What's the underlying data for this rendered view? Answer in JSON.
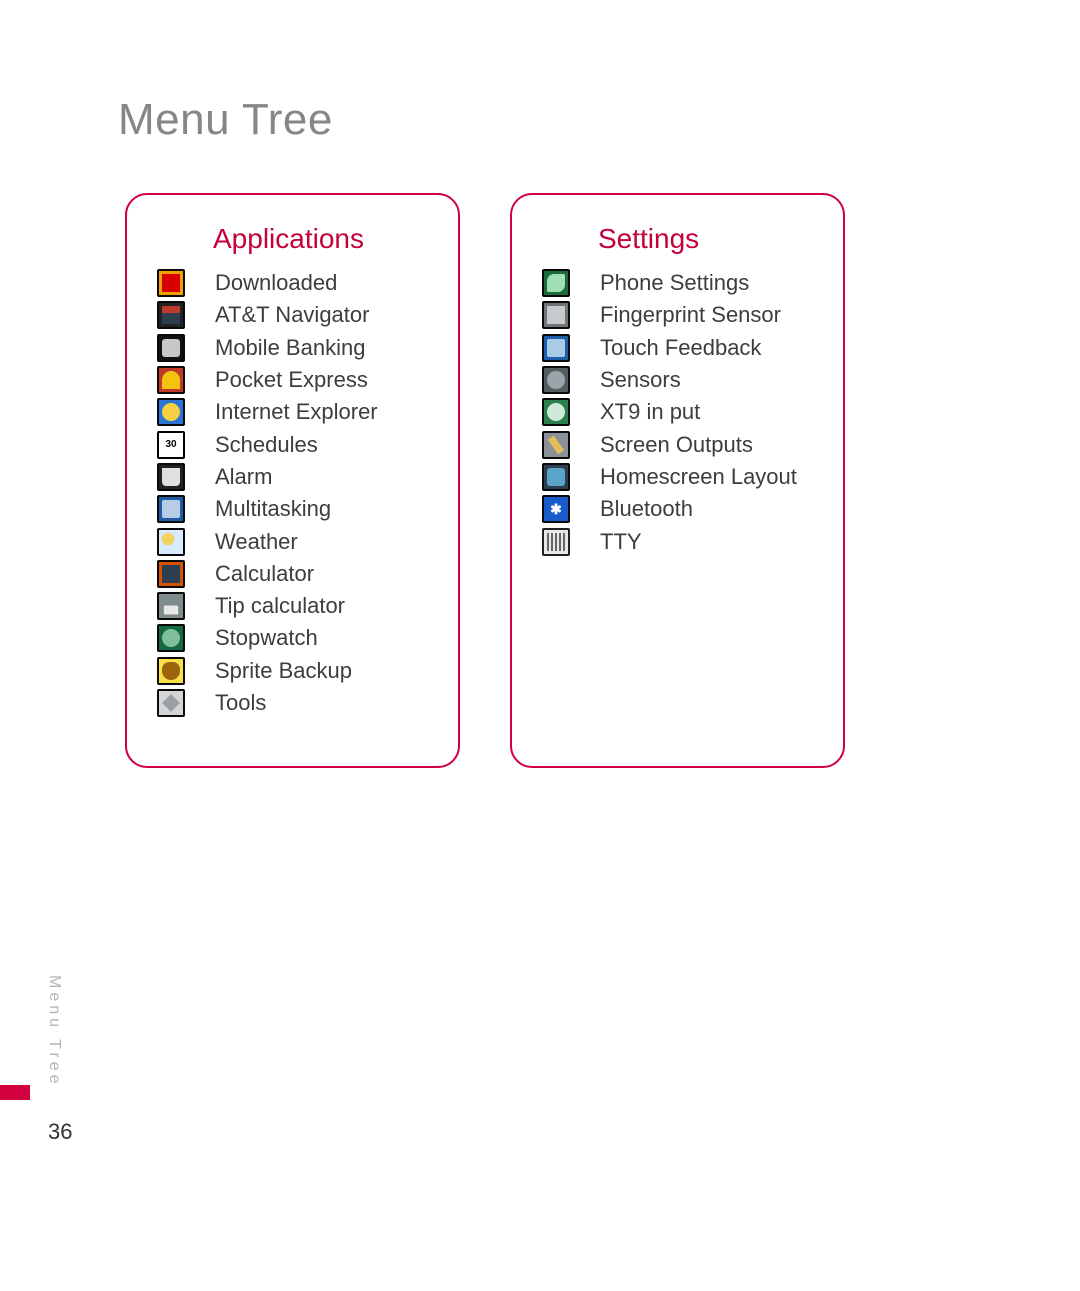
{
  "page": {
    "title": "Menu Tree",
    "section_label": "Menu Tree",
    "number": "36"
  },
  "accent_color": "#d1003f",
  "applications": {
    "heading": "Applications",
    "items": [
      {
        "label": "Downloaded",
        "icon": "download-icon"
      },
      {
        "label": "AT&T Navigator",
        "icon": "att-navigator-icon"
      },
      {
        "label": "Mobile Banking",
        "icon": "mobile-banking-icon"
      },
      {
        "label": "Pocket Express",
        "icon": "pocket-express-icon"
      },
      {
        "label": "Internet Explorer",
        "icon": "internet-explorer-icon"
      },
      {
        "label": "Schedules",
        "icon": "calendar-icon",
        "badge": "30"
      },
      {
        "label": "Alarm",
        "icon": "alarm-clock-icon"
      },
      {
        "label": "Multitasking",
        "icon": "multitasking-icon"
      },
      {
        "label": "Weather",
        "icon": "weather-icon"
      },
      {
        "label": "Calculator",
        "icon": "calculator-icon"
      },
      {
        "label": "Tip calculator",
        "icon": "tip-calculator-icon"
      },
      {
        "label": "Stopwatch",
        "icon": "stopwatch-icon"
      },
      {
        "label": "Sprite Backup",
        "icon": "sprite-backup-icon"
      },
      {
        "label": "Tools",
        "icon": "tools-icon"
      }
    ]
  },
  "settings": {
    "heading": "Settings",
    "items": [
      {
        "label": "Phone Settings",
        "icon": "phone-settings-icon"
      },
      {
        "label": "Fingerprint Sensor",
        "icon": "fingerprint-icon"
      },
      {
        "label": "Touch Feedback",
        "icon": "touch-feedback-icon"
      },
      {
        "label": "Sensors",
        "icon": "sensors-icon"
      },
      {
        "label": "XT9 in put",
        "icon": "xt9-input-icon"
      },
      {
        "label": "Screen Outputs",
        "icon": "screen-outputs-icon"
      },
      {
        "label": "Homescreen Layout",
        "icon": "homescreen-layout-icon"
      },
      {
        "label": "Bluetooth",
        "icon": "bluetooth-icon",
        "badge": "✱"
      },
      {
        "label": "TTY",
        "icon": "tty-icon"
      }
    ]
  }
}
